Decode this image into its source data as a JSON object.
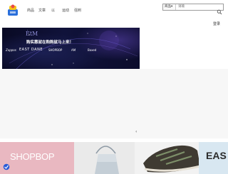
{
  "nav": {
    "items": [
      {
        "label": "商品"
      },
      {
        "label": "文章"
      },
      {
        "label": "以"
      },
      {
        "label": "运动"
      },
      {
        "label": "强到"
      }
    ]
  },
  "search": {
    "scope_label": "商品▾",
    "placeholder": "请输"
  },
  "header": {
    "login_label": "登录"
  },
  "banner": {
    "brand": "ÈtM",
    "tagline": "购实惠就在购购就马上来！",
    "partners": [
      "Zappos",
      "EAST DANE",
      "SHOPBOP",
      "AM",
      "Boxed"
    ]
  },
  "carousel": {
    "arrow_glyph": "‹"
  },
  "tiles": [
    {
      "brand": "SHOPBOP",
      "bg": "#e9b8c1"
    },
    {
      "brand": "",
      "bg": "#eaeaea"
    },
    {
      "brand": "EAS",
      "bg": "#d8e7f1"
    }
  ],
  "colors": {
    "banner_bg": "#0d0f30",
    "accent_pink": "#e9b8c1",
    "accent_blue": "#d8e7f1"
  },
  "icons": [
    "logo-icon",
    "search-icon"
  ]
}
